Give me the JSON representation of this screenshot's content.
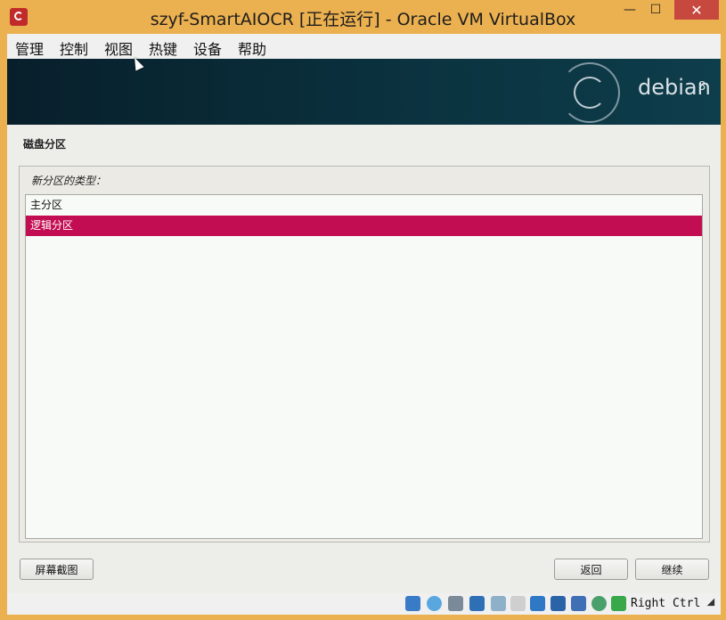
{
  "window": {
    "title": "szyf-SmartAIOCR [正在运行] - Oracle VM VirtualBox",
    "minimize_symbol": "—",
    "maximize_symbol": "☐",
    "close_symbol": "✕"
  },
  "menubar": {
    "items": [
      {
        "label": "管理",
        "icon": "none"
      },
      {
        "label": "控制",
        "icon": "none"
      },
      {
        "label": "视图",
        "icon": "none"
      },
      {
        "label": "热键",
        "icon": "none"
      },
      {
        "label": "设备",
        "icon": "none"
      },
      {
        "label": "帮助",
        "icon": "none"
      }
    ]
  },
  "banner": {
    "brand": "debian",
    "version": "8"
  },
  "installer": {
    "section_title": "磁盘分区",
    "panel_label": "新分区的类型：",
    "options": [
      {
        "label": "主分区",
        "selected": false
      },
      {
        "label": "逻辑分区",
        "selected": true
      }
    ],
    "screenshot_button": "屏幕截图",
    "back_button": "返回",
    "continue_button": "继续"
  },
  "statusbar": {
    "host_key": "Right Ctrl",
    "icons": [
      "hard-disk-icon",
      "optical-drive-icon",
      "usb-icon",
      "network-icon",
      "shared-folders-icon",
      "display-icon",
      "video-capture-icon",
      "cpu-icon",
      "virtualization-icon",
      "mouse-integration-icon",
      "download-icon"
    ]
  },
  "colors": {
    "title_bar": "#ebb04f",
    "selection": "#c30d52",
    "close_button": "#c7483f"
  }
}
